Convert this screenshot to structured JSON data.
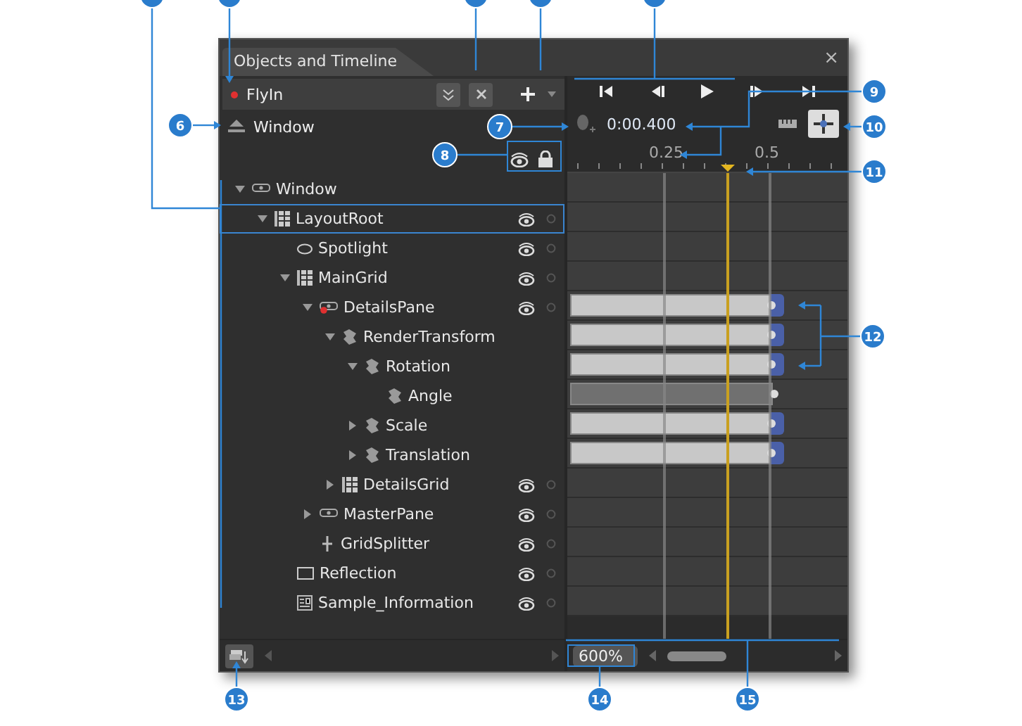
{
  "panel": {
    "title": "Objects and Timeline",
    "close": "×"
  },
  "storyboard": {
    "name": "FlyIn",
    "recording": true
  },
  "scope": {
    "name": "Window"
  },
  "timeline": {
    "time": "0:00.400",
    "ruler": [
      "0.25",
      "0.5"
    ],
    "zoom": "600%"
  },
  "tree": [
    {
      "name": "Window",
      "kind": "pane",
      "selected": false,
      "expanded": true,
      "eye": false,
      "animated": false,
      "children": [
        {
          "name": "LayoutRoot",
          "kind": "grid",
          "selected": true,
          "expanded": true,
          "eye": true,
          "animated": false,
          "children": [
            {
              "name": "Spotlight",
              "kind": "ellipse",
              "selected": false,
              "eye": true,
              "animated": false
            },
            {
              "name": "MainGrid",
              "kind": "grid",
              "selected": false,
              "expanded": true,
              "eye": true,
              "animated": false,
              "children": [
                {
                  "name": "DetailsPane",
                  "kind": "pane",
                  "selected": false,
                  "expanded": true,
                  "eye": true,
                  "recorded": true,
                  "animated": true,
                  "keyframed": true,
                  "children": [
                    {
                      "name": "RenderTransform",
                      "kind": "transform",
                      "selected": false,
                      "expanded": true,
                      "eye": false,
                      "animated": true,
                      "keyframed": true,
                      "children": [
                        {
                          "name": "Rotation",
                          "kind": "transform",
                          "selected": false,
                          "expanded": true,
                          "eye": false,
                          "animated": true,
                          "keyframed": true,
                          "children": [
                            {
                              "name": "Angle",
                              "kind": "transform",
                              "selected": false,
                              "eye": false,
                              "animated": true,
                              "keyframed": false
                            }
                          ]
                        },
                        {
                          "name": "Scale",
                          "kind": "transform",
                          "selected": false,
                          "expanded": false,
                          "eye": false,
                          "animated": true,
                          "keyframed": true
                        },
                        {
                          "name": "Translation",
                          "kind": "transform",
                          "selected": false,
                          "expanded": false,
                          "eye": false,
                          "animated": true,
                          "keyframed": true
                        }
                      ]
                    },
                    {
                      "name": "DetailsGrid",
                      "kind": "grid",
                      "selected": false,
                      "expanded": false,
                      "eye": true,
                      "animated": false
                    }
                  ]
                },
                {
                  "name": "MasterPane",
                  "kind": "pane",
                  "selected": false,
                  "expanded": false,
                  "eye": true,
                  "animated": false
                },
                {
                  "name": "GridSplitter",
                  "kind": "splitter",
                  "selected": false,
                  "eye": true,
                  "animated": false
                }
              ]
            },
            {
              "name": "Reflection",
              "kind": "rectangle",
              "selected": false,
              "eye": true,
              "animated": false
            },
            {
              "name": "Sample_Information",
              "kind": "info",
              "selected": false,
              "eye": true,
              "animated": false
            }
          ]
        }
      ]
    }
  ],
  "callouts": [
    "6",
    "7",
    "8",
    "9",
    "10",
    "11",
    "12",
    "13",
    "14",
    "15"
  ]
}
